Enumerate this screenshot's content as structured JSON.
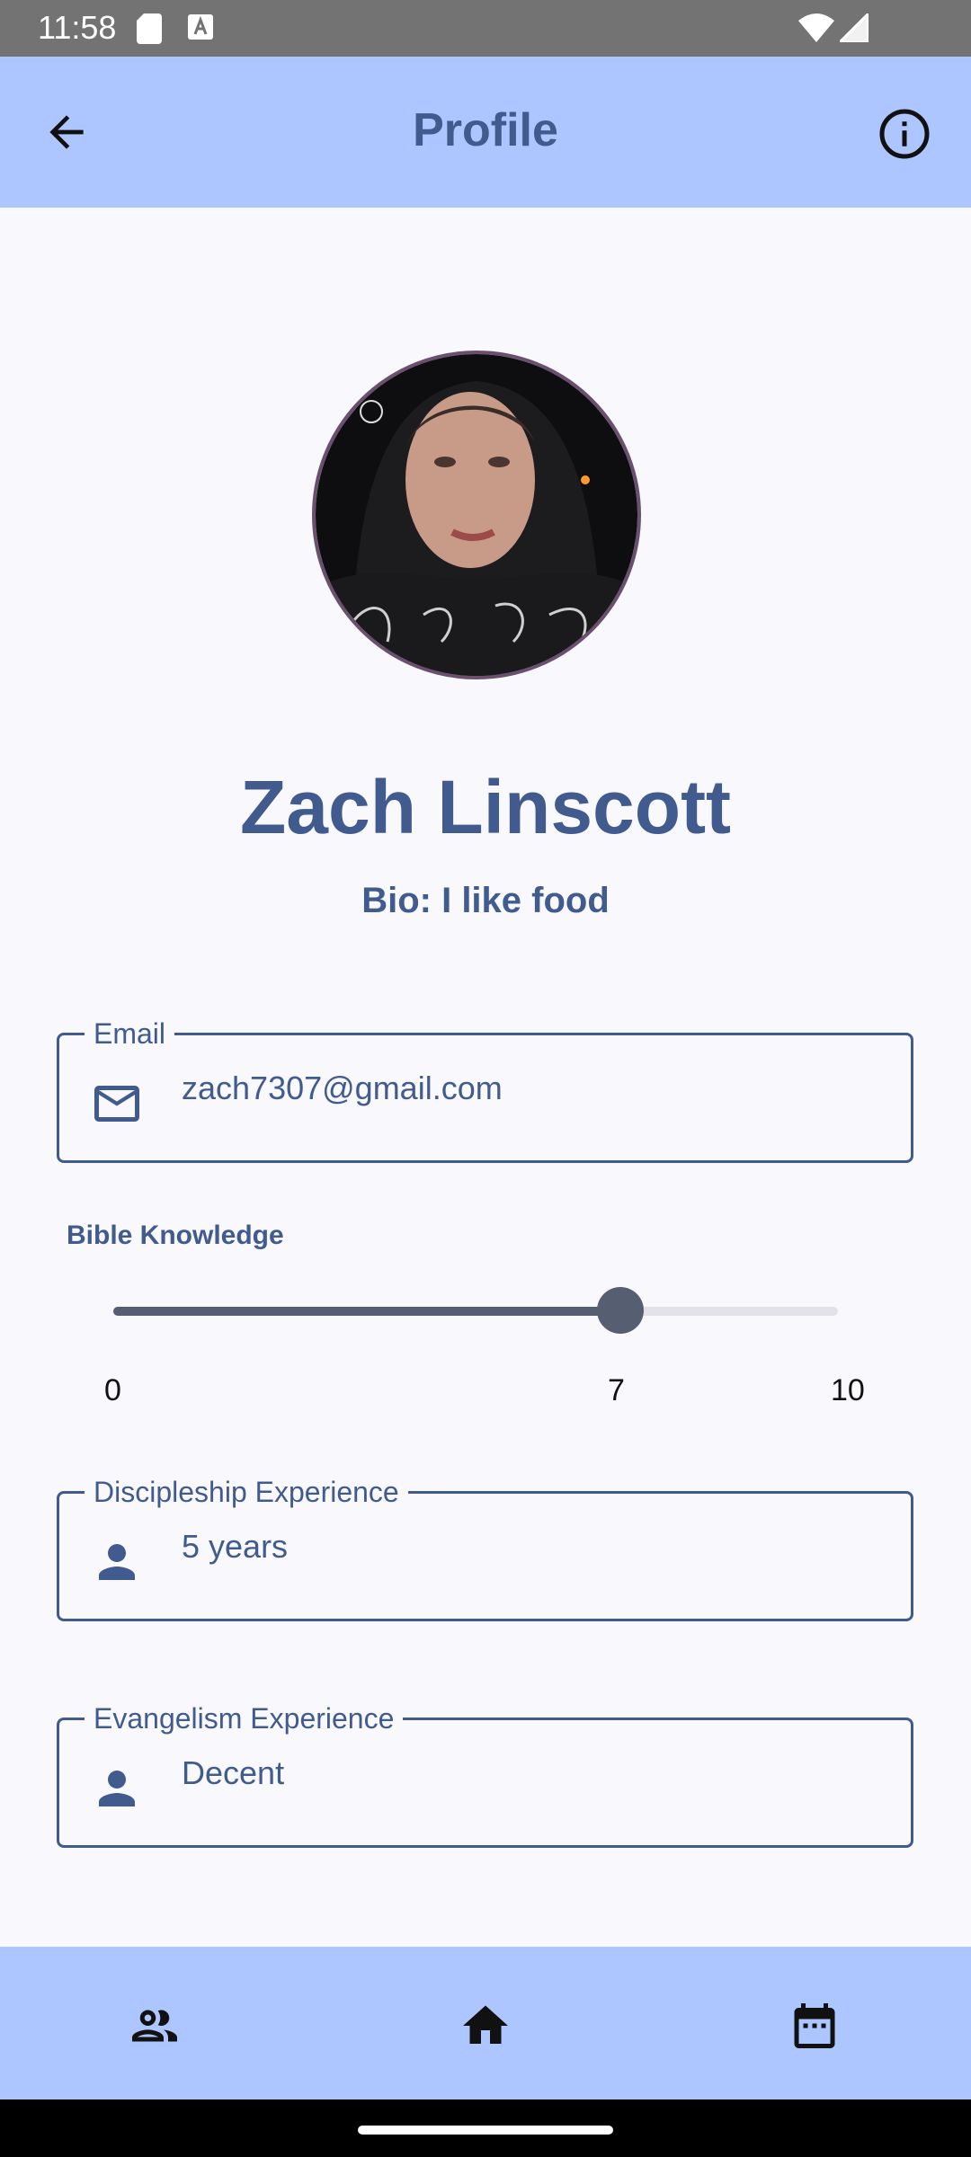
{
  "status_bar": {
    "time": "11:58"
  },
  "app_bar": {
    "title": "Profile"
  },
  "profile": {
    "name": "Zach Linscott",
    "bio": "Bio: I like food"
  },
  "email_field": {
    "label": "Email",
    "value": "zach7307@gmail.com"
  },
  "bible_knowledge": {
    "label": "Bible Knowledge",
    "min": 0,
    "max": 10,
    "value": 7,
    "min_label": "0",
    "value_label": "7",
    "max_label": "10"
  },
  "discipleship_field": {
    "label": "Discipleship Experience",
    "value": "5 years"
  },
  "evangelism_field": {
    "label": "Evangelism Experience",
    "value": "Decent"
  },
  "bottom_nav": {
    "items": [
      {
        "icon": "people-icon"
      },
      {
        "icon": "home-icon"
      },
      {
        "icon": "calendar-icon"
      }
    ]
  },
  "colors": {
    "app_bar": "#adc6ff",
    "primary": "#415b8f",
    "background": "#f8f8fd",
    "slider": "#565e71"
  }
}
